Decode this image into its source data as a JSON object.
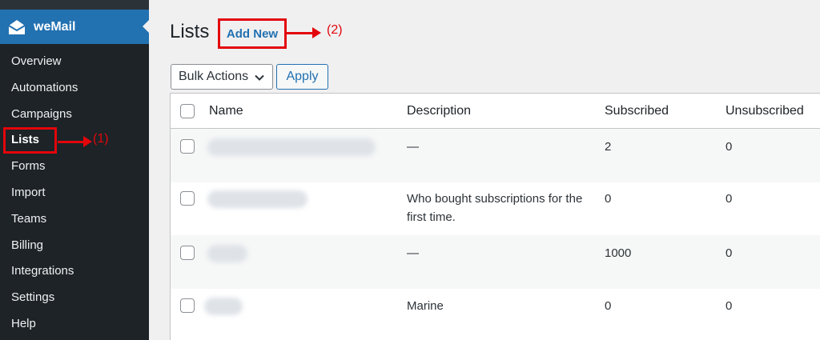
{
  "sidebar": {
    "brand": "weMail",
    "items": [
      "Overview",
      "Automations",
      "Campaigns",
      "Lists",
      "Forms",
      "Import",
      "Teams",
      "Billing",
      "Integrations",
      "Settings",
      "Help"
    ],
    "current": "Lists"
  },
  "annotations": {
    "step1": "(1)",
    "step2": "(2)"
  },
  "header": {
    "title": "Lists",
    "add_new": "Add New"
  },
  "toolbar": {
    "bulk_actions": "Bulk Actions",
    "apply": "Apply"
  },
  "table": {
    "columns": [
      "Name",
      "Description",
      "Subscribed",
      "Unsubscribed"
    ],
    "rows": [
      {
        "description": "—",
        "subscribed": "2",
        "unsubscribed": "0"
      },
      {
        "description": "Who bought subscriptions for the first time.",
        "subscribed": "0",
        "unsubscribed": "0"
      },
      {
        "description": "—",
        "subscribed": "1000",
        "unsubscribed": "0"
      },
      {
        "description": "Marine",
        "subscribed": "0",
        "unsubscribed": "0"
      }
    ]
  },
  "colors": {
    "accent": "#2271b1",
    "sidebar_bg": "#1d2327",
    "annotation": "#e3060b"
  }
}
